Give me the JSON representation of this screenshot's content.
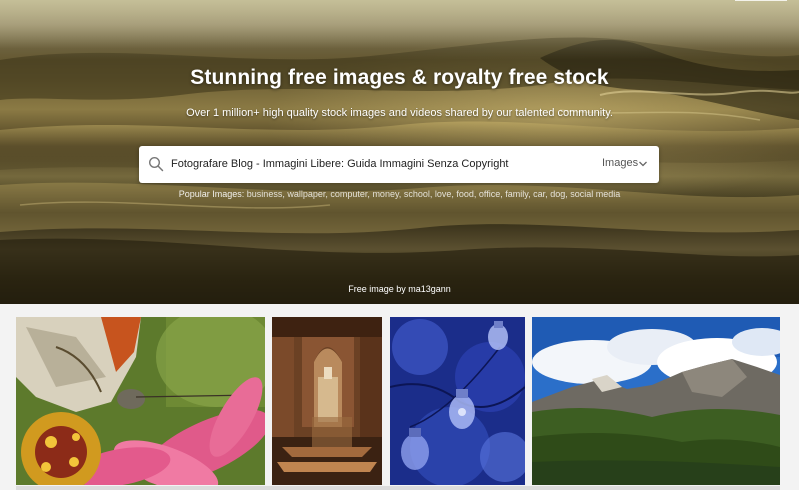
{
  "hero": {
    "title": "Stunning free images & royalty free stock",
    "subtitle": "Over 1 million+ high quality stock images and videos shared by our talented community.",
    "credit": "Free image by ma13gann"
  },
  "search": {
    "value": "Fotografare Blog - Immagini Libere: Guida Immagini Senza Copyright",
    "type_label": "Images"
  },
  "popular": {
    "label": "Popular Images:",
    "tags": [
      "business",
      "wallpaper",
      "computer",
      "money",
      "school",
      "love",
      "food",
      "office",
      "family",
      "car",
      "dog",
      "social media"
    ]
  },
  "gallery": {
    "photos": [
      {
        "subject": "butterfly on pink flower"
      },
      {
        "subject": "arched stone corridor"
      },
      {
        "subject": "blue light bulbs"
      },
      {
        "subject": "mountain landscape"
      }
    ]
  },
  "colors": {
    "accent_white": "#ffffff",
    "page_bg": "#f3f3f3"
  }
}
